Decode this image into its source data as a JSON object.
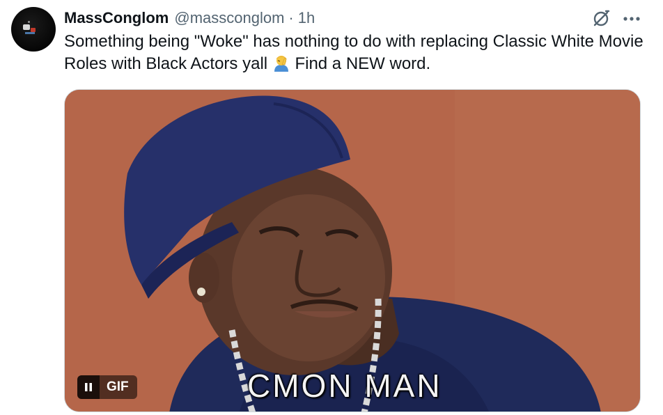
{
  "author": {
    "display_name": "MassConglom",
    "handle": "@massconglom",
    "separator": "·",
    "time": "1h"
  },
  "tweet": {
    "text_part1": "Something being \"Woke\" has nothing to do with replacing Classic White Movie Roles with Black Actors yall",
    "emoji": "person-facepalming",
    "text_part2": " Find a NEW word."
  },
  "media": {
    "caption": "CMON MAN",
    "badge": "GIF",
    "pause_icon": "pause-icon"
  },
  "icons": {
    "grok": "grok-icon",
    "more": "more-icon"
  },
  "colors": {
    "text": "#0f1419",
    "secondary": "#536471",
    "gif_background": "#b46548",
    "cap": "#1f2a5a"
  }
}
